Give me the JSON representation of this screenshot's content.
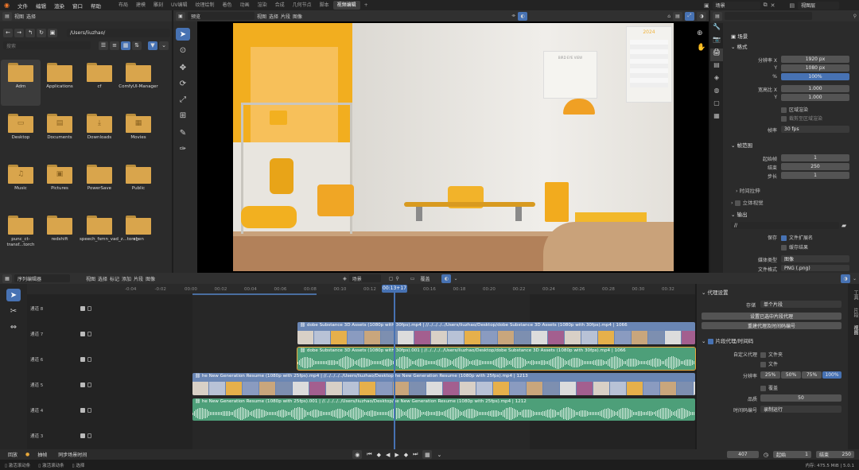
{
  "topbar": {
    "menu": [
      "文件",
      "编辑",
      "渲染",
      "窗口",
      "帮助"
    ],
    "workspaces": [
      "布局",
      "建模",
      "雕刻",
      "UV编辑",
      "纹理绘制",
      "着色",
      "动画",
      "渲染",
      "合成",
      "几何节点",
      "脚本",
      "视频编辑"
    ],
    "active_workspace": "视频编辑",
    "add_label": "+"
  },
  "file_browser": {
    "menu": [
      "视图",
      "选择"
    ],
    "path": "/Users/liuzhao/",
    "search_placeholder": "搜索",
    "folders": [
      {
        "label": "Adm",
        "glyph": ""
      },
      {
        "label": "Applications",
        "glyph": ""
      },
      {
        "label": "cf",
        "glyph": ""
      },
      {
        "label": "ComfyUI-Manager",
        "glyph": ""
      },
      {
        "label": "Desktop",
        "glyph": "▭"
      },
      {
        "label": "Documents",
        "glyph": "▤"
      },
      {
        "label": "Downloads",
        "glyph": "⤓"
      },
      {
        "label": "Movies",
        "glyph": "▦"
      },
      {
        "label": "Music",
        "glyph": "♫"
      },
      {
        "label": "Pictures",
        "glyph": "▣"
      },
      {
        "label": "PowerSave",
        "glyph": ""
      },
      {
        "label": "Public",
        "glyph": ""
      },
      {
        "label": "punc_ct-transf...torch",
        "glyph": ""
      },
      {
        "label": "redshift",
        "glyph": ""
      },
      {
        "label": "speech_fsmn_vad_z...torch",
        "glyph": ""
      },
      {
        "label": "xgen",
        "glyph": ""
      }
    ]
  },
  "preview": {
    "mode": "预览",
    "menu": [
      "视图",
      "选择",
      "片段",
      "图像"
    ],
    "poster_text": "BIRD EYE VIEW",
    "calendar_year": "2024"
  },
  "properties": {
    "header": "场景",
    "view_layer": "视图层",
    "search_placeholder": "",
    "format": {
      "title": "格式",
      "res_x_label": "分辨率 X",
      "res_x": "1920 px",
      "res_y_label": "Y",
      "res_y": "1080 px",
      "pct_label": "%",
      "pct": "100%",
      "aspect_x_label": "宽高比 X",
      "aspect_x": "1.000",
      "aspect_y_label": "Y",
      "aspect_y": "1.000",
      "region_render": "区域渲染",
      "crop_region": "裁剪至区域渲染",
      "fps_label": "帧率",
      "fps": "30 fps"
    },
    "frame_range": {
      "title": "帧范围",
      "start_label": "起始帧",
      "start": "1",
      "end_label": "结束",
      "end": "250",
      "step_label": "步长",
      "step": "1"
    },
    "time_stretch": "时间拉伸",
    "stereoscopy": "立体视觉",
    "output": {
      "title": "输出",
      "path": "//",
      "save_label": "保存",
      "file_ext": "文件扩展名",
      "cache_result": "缓存结果",
      "media_type_label": "媒体类型",
      "media_type": "图像",
      "file_format_label": "文件格式",
      "file_format": "PNG (.png)"
    }
  },
  "sequencer": {
    "editor": "序列编辑器",
    "menu": [
      "视图",
      "选择",
      "标记",
      "添加",
      "片段",
      "图像"
    ],
    "scene": "场景",
    "overlay": "覆盖",
    "ticks": [
      "-0:04",
      "-0:02",
      "00:00",
      "00:02",
      "00:04",
      "00:06",
      "00:08",
      "00:10",
      "00:12",
      "00:14",
      "00:16",
      "00:18",
      "00:20",
      "00:22",
      "00:24",
      "00:26",
      "00:28",
      "00:30",
      "00:32"
    ],
    "playhead": "00:13+17",
    "channels": [
      "通道 8",
      "通道 7",
      "通道 6",
      "通道 5",
      "通道 4",
      "通道 3"
    ],
    "clips": [
      {
        "label": "dobe Substance 3D Assets (1080p with 30fps).mp4 | //../../../../Users/liuzhao/Desktop/dobe Substance 3D Assets (1080p with 30fps).mp4 | 1066",
        "kind": "movie"
      },
      {
        "label": "dobe Substance 3D Assets (1080p with 30fps).001 | //../../../../Users/liuzhao/Desktop/dobe Substance 3D Assets (1080p with 30fps).mp4 | 1066",
        "kind": "sound"
      },
      {
        "label": "he New Generation Resume (1080p with 25fps).mp4 | //../../../../Users/liuzhao/Desktop/he New Generation Resume (1080p with 25fps).mp4 | 1213",
        "kind": "movie"
      },
      {
        "label": "he New Generation Resume (1080p with 25fps).001 | //../../../../Users/liuzhao/Desktop/he New Generation Resume (1080p with 25fps).mp4 | 1212",
        "kind": "sound"
      }
    ]
  },
  "proxy_panel": {
    "title": "代理设置",
    "storage_label": "存储",
    "storage": "单个片段",
    "set_selected": "设置已选中片段代理",
    "rebuild": "重建代理及时间码编号",
    "strip_title": "片段代理/时间码",
    "custom_proxy": "自定义代理",
    "file_dir": "文件夹",
    "file": "文件",
    "resolution_label": "分辨率",
    "res_options": [
      "25%",
      "50%",
      "75%",
      "100%"
    ],
    "active_res": "100%",
    "overwrite": "覆盖",
    "quality_label": "品质",
    "quality": "50",
    "timecode_label": "时间码编号",
    "timecode": "录制运行"
  },
  "side_tabs": [
    "工具",
    "片段",
    "视图"
  ],
  "playback": {
    "menu": [
      "回放",
      "抽帧",
      "同步场景时间"
    ],
    "frame": "407",
    "start_label": "起始",
    "start": "1",
    "end_label": "结束",
    "end": "250"
  },
  "statusbar": {
    "items": [
      "激活滚动条",
      "激活滚动条",
      "选择"
    ],
    "memory": "内存: 475.5 MiB | 5.0.1"
  }
}
